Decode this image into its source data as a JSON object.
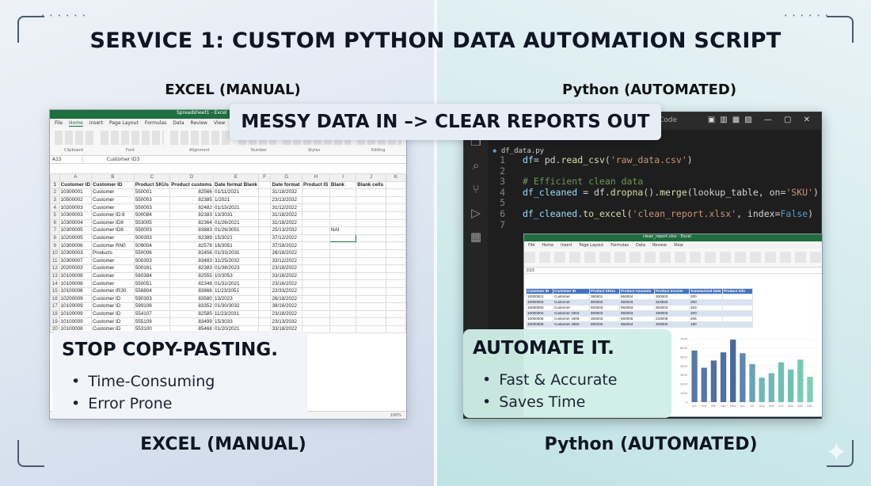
{
  "main_title": "SERVICE 1: CUSTOM PYTHON DATA AUTOMATION SCRIPT",
  "left_top_label": "EXCEL (MANUAL)",
  "right_top_label": "Python (AUTOMATED)",
  "left_bottom_label": "EXCEL (MANUAL)",
  "right_bottom_label": "Python (AUTOMATED)",
  "banner": "MESSY DATA IN –> CLEAR REPORTS OUT",
  "excel": {
    "window_title": "Spreadsheet1 - Excel",
    "menu": [
      "File",
      "Home",
      "Insert",
      "Page Layout",
      "Formulas",
      "Data",
      "Review",
      "View",
      "Help"
    ],
    "ribbon_groups": [
      "Clipboard",
      "Font",
      "Alignment",
      "Number",
      "Styles",
      "Editing"
    ],
    "name_box": "A15",
    "formula": "Customer ID3",
    "columns": [
      "A",
      "B",
      "C",
      "D",
      "E",
      "F",
      "G",
      "H",
      "I",
      "J",
      "K"
    ],
    "headers": [
      "Customer ID",
      "Customer ID",
      "Product SKUs",
      "Product customs",
      "Date format Blank",
      "",
      "Date format",
      "Product IS",
      "Blank",
      "Blank cells"
    ],
    "rows": [
      [
        "10300001",
        "Customer",
        "550001",
        "82566",
        "01/11/2021",
        "",
        "31/18/2032",
        "",
        "",
        ""
      ],
      [
        "10500002",
        "Customer",
        "550003",
        "82385",
        "1/2021",
        "",
        "23/13/2032",
        "",
        "",
        ""
      ],
      [
        "10200003",
        "Customer",
        "550003",
        "82482",
        "01/15/2021",
        "",
        "31/12/2022",
        "",
        "",
        ""
      ],
      [
        "10300003",
        "Customer ID:8",
        "500084",
        "82383",
        "13/3031",
        "",
        "31/18/2022",
        "",
        "",
        ""
      ],
      [
        "10300004",
        "Customer ID8",
        "553005",
        "82364",
        "01/26/2021",
        "",
        "31/18/2022",
        "",
        "",
        ""
      ],
      [
        "10300005",
        "Customer ID8",
        "550003",
        "83883",
        "01/26/3051",
        "",
        "25/13/2032",
        "",
        "NAI",
        ""
      ],
      [
        "10200005",
        "Customer",
        "500303",
        "82389",
        "15/3021",
        "",
        "37/12/2022",
        "",
        "",
        ""
      ],
      [
        "10300006",
        "Customer RN0",
        "509004",
        "82578",
        "16/3051",
        "",
        "37/18/2022",
        "",
        "",
        ""
      ],
      [
        "10300003",
        "Products",
        "550006",
        "82456",
        "01/33/2031",
        "",
        "26/18/2022",
        "",
        "",
        ""
      ],
      [
        "10300007",
        "Customer",
        "500303",
        "83483",
        "31/25/2032",
        "",
        "33/12/2022",
        "",
        "",
        ""
      ],
      [
        "20200003",
        "Customer",
        "500161",
        "82383",
        "01/38/2023",
        "",
        "23/18/2022",
        "",
        "",
        ""
      ],
      [
        "10100008",
        "Customer",
        "560384",
        "82555",
        "10/3053",
        "",
        "33/16/2022",
        "",
        "",
        ""
      ],
      [
        "10100008",
        "Customer",
        "550051",
        "82348",
        "01/31/2021",
        "",
        "23/16/2022",
        "",
        "",
        ""
      ],
      [
        "10100006",
        "Customer IR30",
        "556804",
        "83866",
        "11/23/2051",
        "",
        "23/33/2022",
        "",
        "",
        ""
      ],
      [
        "10200009",
        "Customer ID",
        "590303",
        "83580",
        "13/2023",
        "",
        "26/18/2022",
        "",
        "",
        ""
      ],
      [
        "10100009",
        "Customer ID",
        "599108",
        "83352",
        "01/30/3032",
        "",
        "38/16/2022",
        "",
        "",
        ""
      ],
      [
        "10100009",
        "Customer ID",
        "554107",
        "82585",
        "11/23/2031",
        "",
        "23/18/2022",
        "",
        "",
        ""
      ],
      [
        "10100009",
        "Customer ID",
        "555109",
        "83499",
        "15/3033",
        "",
        "23/13/2032",
        "",
        "",
        ""
      ],
      [
        "10100008",
        "Customer ID",
        "553100",
        "85468",
        "01/20/2021",
        "",
        "33/18/2022",
        "",
        "",
        ""
      ]
    ],
    "zoom": "100%"
  },
  "editor": {
    "title_word": "Code",
    "tab": "df_data.py",
    "lines": [
      {
        "n": "1",
        "parts": [
          [
            "kw",
            "df"
          ],
          [
            "",
            "= pd."
          ],
          [
            "fn",
            "read_csv"
          ],
          [
            "",
            "("
          ],
          [
            "str",
            "'raw_data.csv'"
          ],
          [
            "",
            ")"
          ]
        ]
      },
      {
        "n": "2",
        "parts": []
      },
      {
        "n": "3",
        "parts": [
          [
            "cmt",
            "# Efficient clean data"
          ]
        ]
      },
      {
        "n": "4",
        "parts": [
          [
            "kw",
            "df_cleaned"
          ],
          [
            "",
            " = df."
          ],
          [
            "fn",
            "dropna"
          ],
          [
            "",
            "()."
          ],
          [
            "fn",
            "merge"
          ],
          [
            "",
            "(lookup_table, on="
          ],
          [
            "str",
            "'SKU'"
          ],
          [
            "",
            ")"
          ]
        ]
      },
      {
        "n": "5",
        "parts": []
      },
      {
        "n": "6",
        "parts": [
          [
            "kw",
            "df_cleaned"
          ],
          [
            "",
            "."
          ],
          [
            "fn",
            "to_excel"
          ],
          [
            "",
            "("
          ],
          [
            "str",
            "'clean_report.xlsx'"
          ],
          [
            "",
            ", index="
          ],
          [
            "bool",
            "False"
          ],
          [
            "",
            ")"
          ]
        ]
      },
      {
        "n": "7",
        "parts": []
      }
    ]
  },
  "mini_excel": {
    "title": "clean_report.xlsx - Excel",
    "menu": [
      "File",
      "Home",
      "Insert",
      "Page Layout",
      "Formulas",
      "Data",
      "Review",
      "View"
    ],
    "formula": "D15",
    "headers": [
      "Customer ID",
      "Customer ID",
      "Product SKUs",
      "Product Amounts",
      "Product Income",
      "Summarized Date",
      "Product info"
    ],
    "rows": [
      [
        "10000001",
        "Customer",
        "380001",
        "550004",
        "300003",
        "200",
        ""
      ],
      [
        "10000003",
        "Customer",
        "500003",
        "550033",
        "310533",
        "200",
        ""
      ],
      [
        "10000003",
        "Customer",
        "500003",
        "550053",
        "353003",
        "203",
        ""
      ],
      [
        "10000004",
        "Customer 1903",
        "500003",
        "550003",
        "290003",
        "200",
        ""
      ],
      [
        "10000005",
        "Customer 1808",
        "350003",
        "550006",
        "233008",
        "205",
        ""
      ],
      [
        "10000006",
        "Customer 1860",
        "590200",
        "550004",
        "200000",
        "150",
        ""
      ]
    ]
  },
  "chart_data": {
    "type": "bar",
    "categories": [
      "Jan",
      "Feb",
      "Mar",
      "Apr",
      "May",
      "Jun",
      "Jul",
      "Aug",
      "Sep",
      "Oct",
      "Nov",
      "Dec",
      "Dec"
    ],
    "values": [
      5700,
      3800,
      4600,
      5500,
      6900,
      5400,
      4200,
      2700,
      3200,
      4400,
      3600,
      4700,
      2800
    ],
    "colors": [
      "#5677a8",
      "#5677a8",
      "#4f6fa3",
      "#4f6fa3",
      "#48679b",
      "#5f86ad",
      "#6aa3b3",
      "#6fb8b5",
      "#6fb8b5",
      "#6fc1b3",
      "#6fc1b3",
      "#78c9b4",
      "#7ccfb4"
    ],
    "yticks": [
      "7000",
      "6000",
      "5000",
      "4000",
      "3000",
      "2000",
      "1000",
      "0"
    ],
    "ylim": [
      0,
      7000
    ]
  },
  "left_card": {
    "title": "STOP COPY-PASTING.",
    "items": [
      "Time-Consuming",
      "Error Prone"
    ]
  },
  "right_card": {
    "title": "AUTOMATE IT.",
    "items": [
      "Fast & Accurate",
      "Saves Time"
    ]
  }
}
